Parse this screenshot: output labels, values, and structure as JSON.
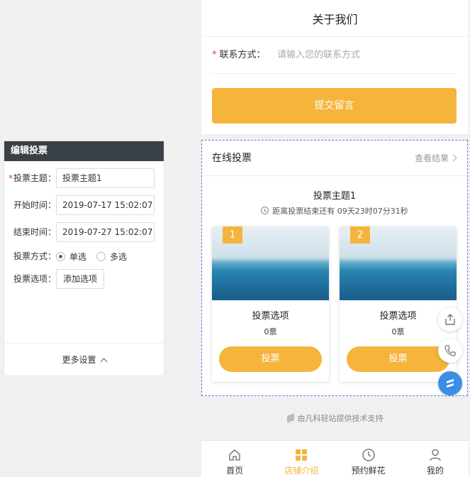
{
  "editor": {
    "title": "编辑投票",
    "required_mark": "*",
    "topic_label": "投票主题：",
    "topic_value": "投票主题1",
    "start_label": "开始时间：",
    "start_value": "2019-07-17 15:02:07",
    "end_label": "结束时间：",
    "end_value": "2019-07-27 15:02:07",
    "mode_label": "投票方式：",
    "mode_single": "单选",
    "mode_multi": "多选",
    "mode_selected": "单选",
    "options_label": "投票选项：",
    "add_option": "添加选项",
    "more_settings": "更多设置"
  },
  "contact": {
    "title": "关于我们",
    "required_mark": "*",
    "field_label": "联系方式：",
    "field_placeholder": "请输入您的联系方式",
    "submit": "提交留言"
  },
  "vote": {
    "header": "在线投票",
    "view_results": "查看结果",
    "topic": "投票主题1",
    "countdown": "距离投票结束还有 09天23时07分31秒",
    "options": [
      {
        "num": "1",
        "name": "投票选项",
        "count": "0票",
        "button": "投票"
      },
      {
        "num": "2",
        "name": "投票选项",
        "count": "0票",
        "button": "投票"
      }
    ]
  },
  "support": "由凡科轻站提供技术支持",
  "tabbar": [
    {
      "label": "首页",
      "icon": "home-icon",
      "active": false
    },
    {
      "label": "店铺介绍",
      "icon": "grid-icon",
      "active": true
    },
    {
      "label": "预约鲜花",
      "icon": "clock-icon",
      "active": false
    },
    {
      "label": "我的",
      "icon": "user-icon",
      "active": false
    }
  ],
  "floating_buttons": [
    "share-icon",
    "phone-icon",
    "brand-logo-icon"
  ],
  "colors": {
    "accent": "#f5b43b",
    "editor_header": "#3a4047",
    "selection_border": "#5a7fd6",
    "brand_blue": "#3a8ee6"
  }
}
